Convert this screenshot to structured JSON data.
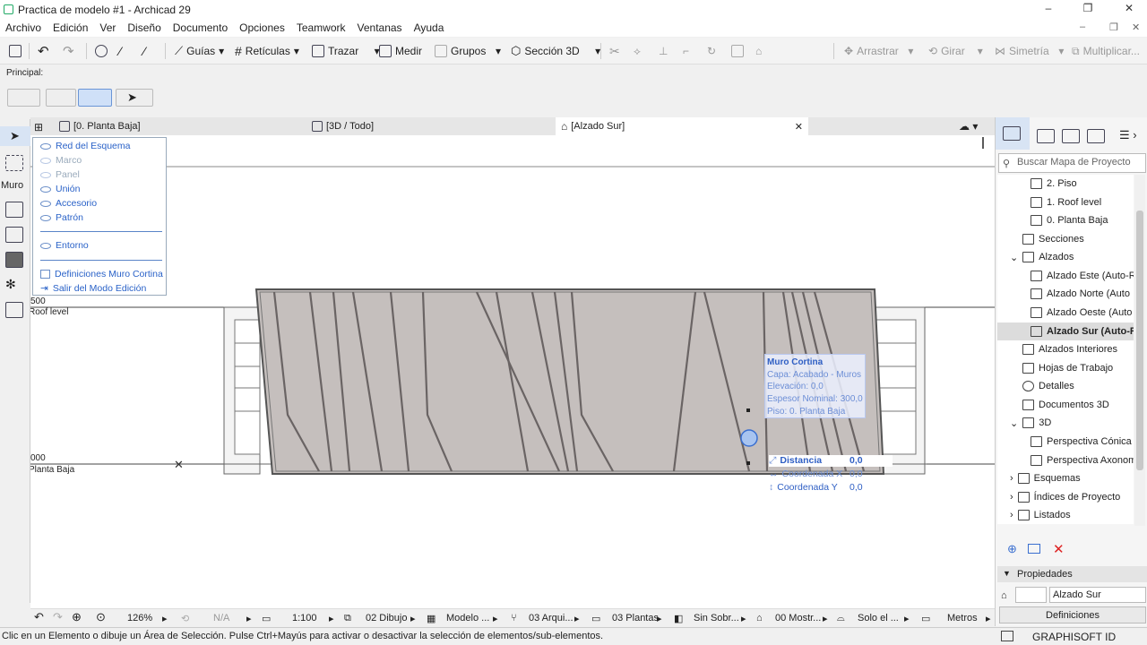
{
  "window": {
    "title": "Practica de modelo #1 - Archicad 29",
    "min": "–",
    "restore": "❐",
    "close": "✕"
  },
  "menu": [
    "Archivo",
    "Edición",
    "Ver",
    "Diseño",
    "Documento",
    "Opciones",
    "Teamwork",
    "Ventanas",
    "Ayuda"
  ],
  "toolbar": {
    "guias": "Guías",
    "reticulas": "Retículas",
    "trazar": "Trazar",
    "medir": "Medir",
    "grupos": "Grupos",
    "seccion3d": "Sección 3D",
    "arrastrar": "Arrastrar",
    "girar": "Girar",
    "simetria": "Simetría",
    "multiplicar": "Multiplicar..."
  },
  "principal_label": "Principal:",
  "left_tool_label": "Muro",
  "tabs": {
    "planta": "[0. Planta Baja]",
    "todo3d": "[3D / Todo]",
    "alzado": "[Alzado Sur]",
    "close": "✕"
  },
  "popup": {
    "items": [
      {
        "label": "Red del Esquema",
        "icon": "hidden-eye-icon",
        "disabled": false
      },
      {
        "label": "Marco",
        "icon": "eye-icon",
        "disabled": true
      },
      {
        "label": "Panel",
        "icon": "eye-icon",
        "disabled": true
      },
      {
        "label": "Unión",
        "icon": "eye-icon",
        "disabled": false
      },
      {
        "label": "Accesorio",
        "icon": "eye-icon",
        "disabled": false
      },
      {
        "label": "Patrón",
        "icon": "hidden-eye-icon",
        "disabled": false
      }
    ],
    "entorno": "Entorno",
    "definiciones": "Definiciones Muro Cortina",
    "salir": "Salir del Modo Edición"
  },
  "levels": {
    "roof_value": "500",
    "roof_label": "Roof level",
    "ground_value": "000",
    "ground_label": "Planta Baja"
  },
  "tooltip": {
    "title": "Muro Cortina",
    "capa": "Capa: Acabado - Muros",
    "elevacion": "Elevación: 0,0",
    "espesor": "Espesor Nominal: 300,0",
    "piso": "Piso: 0. Planta Baja"
  },
  "tracker": {
    "distancia_label": "Distancia",
    "distancia": "0,0",
    "cx_label": "Coordenada X",
    "cx": "0,0",
    "cy_label": "Coordenada Y",
    "cy": "0,0"
  },
  "navigator": {
    "search_placeholder": "Buscar Mapa de Proyecto",
    "items": [
      {
        "label": "2. Piso",
        "indent": 2,
        "sel": false,
        "arrow": ""
      },
      {
        "label": "1. Roof level",
        "indent": 2,
        "sel": false,
        "arrow": ""
      },
      {
        "label": "0. Planta Baja",
        "indent": 2,
        "sel": false,
        "arrow": ""
      },
      {
        "label": "Secciones",
        "indent": 1,
        "sel": false,
        "arrow": ""
      },
      {
        "label": "Alzados",
        "indent": 1,
        "sel": false,
        "arrow": "⌄"
      },
      {
        "label": "Alzado Este (Auto-R",
        "indent": 2,
        "sel": false,
        "arrow": ""
      },
      {
        "label": "Alzado Norte (Auto",
        "indent": 2,
        "sel": false,
        "arrow": ""
      },
      {
        "label": "Alzado Oeste (Auto",
        "indent": 2,
        "sel": false,
        "arrow": ""
      },
      {
        "label": "Alzado Sur (Auto-R",
        "indent": 2,
        "sel": true,
        "arrow": ""
      },
      {
        "label": "Alzados Interiores",
        "indent": 1,
        "sel": false,
        "arrow": ""
      },
      {
        "label": "Hojas de Trabajo",
        "indent": 1,
        "sel": false,
        "arrow": ""
      },
      {
        "label": "Detalles",
        "indent": 1,
        "sel": false,
        "arrow": ""
      },
      {
        "label": "Documentos 3D",
        "indent": 1,
        "sel": false,
        "arrow": ""
      },
      {
        "label": "3D",
        "indent": 1,
        "sel": false,
        "arrow": "⌄"
      },
      {
        "label": "Perspectiva Cónica",
        "indent": 2,
        "sel": false,
        "arrow": ""
      },
      {
        "label": "Perspectiva Axonom",
        "indent": 2,
        "sel": false,
        "arrow": ""
      },
      {
        "label": "Esquemas",
        "indent": 1,
        "sel": false,
        "arrow": "›"
      },
      {
        "label": "Índices de Proyecto",
        "indent": 1,
        "sel": false,
        "arrow": "›"
      },
      {
        "label": "Listados",
        "indent": 1,
        "sel": false,
        "arrow": "›"
      }
    ]
  },
  "properties": {
    "header": "Propiedades",
    "name": "Alzado Sur",
    "definiciones": "Definiciones"
  },
  "bottom": {
    "zoom": "126%",
    "na": "N/A",
    "scale": "1:100",
    "dibujo": "02 Dibujo",
    "modelo": "Modelo ...",
    "arqui": "03 Arqui...",
    "plantas": "03 Plantas",
    "sinsobr": "Sin Sobr...",
    "mostr": "00 Mostr...",
    "solo": "Solo el ...",
    "metros": "Metros"
  },
  "status": {
    "text": "Clic en un Elemento o dibuje un Área de Selección. Pulse Ctrl+Mayús para activar o desactivar la selección de elementos/sub-elementos.",
    "brand": "GRAPHISOFT ID"
  }
}
